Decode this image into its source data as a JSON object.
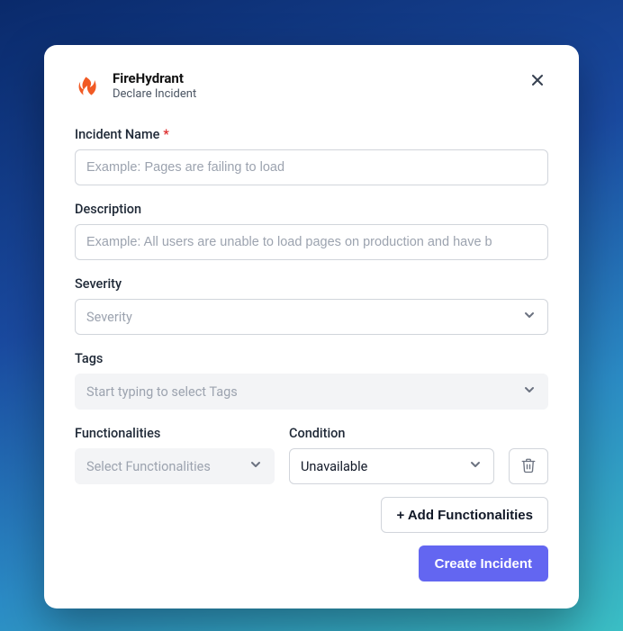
{
  "header": {
    "brand_title": "FireHydrant",
    "brand_subtitle": "Declare Incident"
  },
  "fields": {
    "incident_name": {
      "label": "Incident Name",
      "required_mark": "*",
      "placeholder": "Example: Pages are failing to load",
      "value": ""
    },
    "description": {
      "label": "Description",
      "placeholder": "Example: All users are unable to load pages on production and have b",
      "value": ""
    },
    "severity": {
      "label": "Severity",
      "placeholder": "Severity",
      "value": ""
    },
    "tags": {
      "label": "Tags",
      "placeholder": "Start typing to select Tags",
      "value": ""
    },
    "functionalities": {
      "label": "Functionalities",
      "placeholder": "Select Functionalities",
      "value": ""
    },
    "condition": {
      "label": "Condition",
      "value": "Unavailable"
    }
  },
  "buttons": {
    "add_functionalities": "+ Add Functionalities",
    "create_incident": "Create Incident"
  },
  "icons": {
    "brand": "firehydrant-logo",
    "close": "close-icon",
    "chevron": "chevron-down-icon",
    "trash": "trash-icon"
  },
  "colors": {
    "brand_orange": "#f15a24",
    "primary_button": "#6366f1",
    "required": "#dc2626"
  }
}
